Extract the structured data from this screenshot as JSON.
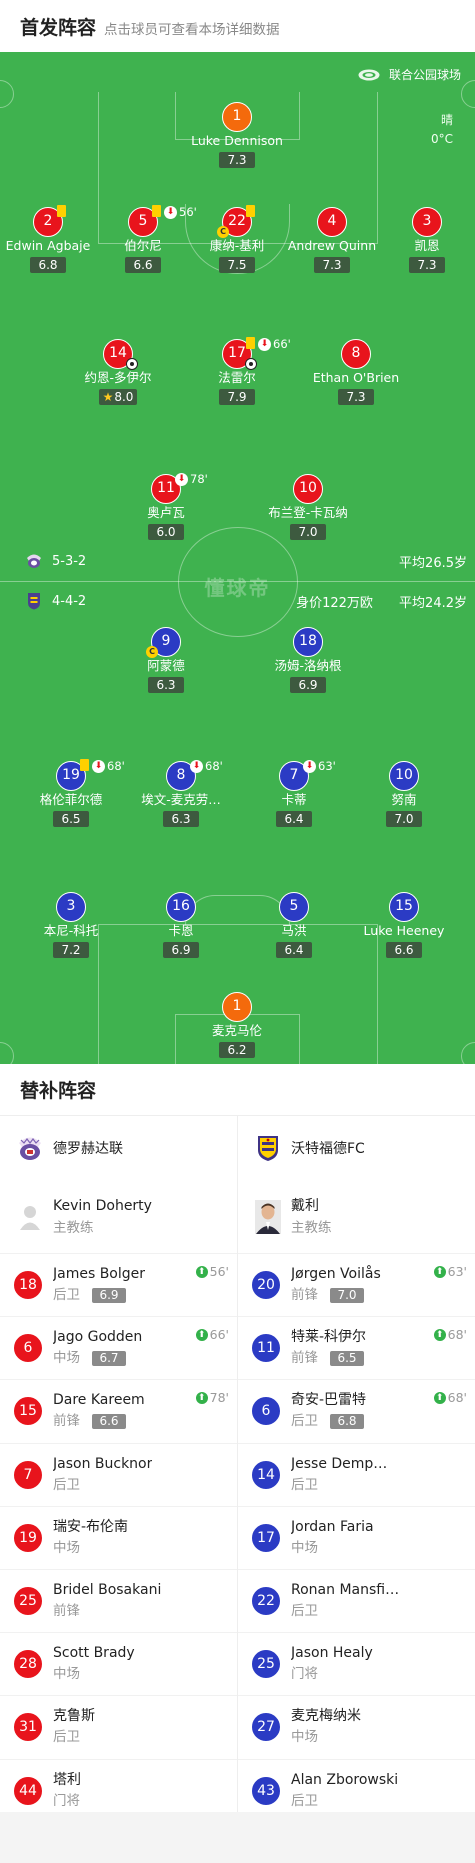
{
  "header": {
    "title": "首发阵容",
    "hint": "点击球员可查看本场详细数据"
  },
  "pitch": {
    "venue": "联合公园球场",
    "weather": "晴",
    "temperature": "0°C",
    "watermark": "懂球帝",
    "home": {
      "formation": "5-3-2",
      "avg_age": "平均26.5岁"
    },
    "away": {
      "formation": "4-4-2",
      "value": "身价122万欧",
      "avg_age": "平均24.2岁"
    },
    "players": [
      {
        "num": "1",
        "name": "Luke Dennison",
        "rating": "7.3",
        "color": "orange"
      },
      {
        "num": "2",
        "name": "Edwin Agbaje",
        "rating": "6.8",
        "color": "red",
        "yellow": true
      },
      {
        "num": "5",
        "name": "伯尔尼",
        "rating": "6.6",
        "color": "red",
        "yellow": true,
        "sub_out": "56'"
      },
      {
        "num": "22",
        "name": "康纳-基利",
        "rating": "7.5",
        "color": "red",
        "yellow": true,
        "captain": true
      },
      {
        "num": "4",
        "name": "Andrew Quinn",
        "rating": "7.3",
        "color": "red"
      },
      {
        "num": "3",
        "name": "凯恩",
        "rating": "7.3",
        "color": "red"
      },
      {
        "num": "14",
        "name": "约恩-多伊尔",
        "rating": "8.0",
        "color": "red",
        "ball": true,
        "star": true
      },
      {
        "num": "17",
        "name": "法雷尔",
        "rating": "7.9",
        "color": "red",
        "yellow": true,
        "sub_out": "66'",
        "ball": true
      },
      {
        "num": "8",
        "name": "Ethan O'Brien",
        "rating": "7.3",
        "color": "red"
      },
      {
        "num": "11",
        "name": "奥卢瓦",
        "rating": "6.0",
        "color": "red",
        "sub_out": "78'"
      },
      {
        "num": "10",
        "name": "布兰登-卡瓦纳",
        "rating": "7.0",
        "color": "red"
      },
      {
        "num": "9",
        "name": "阿蒙德",
        "rating": "6.3",
        "color": "blue",
        "captain": true
      },
      {
        "num": "18",
        "name": "汤姆-洛纳根",
        "rating": "6.9",
        "color": "blue"
      },
      {
        "num": "19",
        "name": "格伦菲尔德",
        "rating": "6.5",
        "color": "blue",
        "yellow": true,
        "sub_out": "68'"
      },
      {
        "num": "8",
        "name": "埃文-麦克劳…",
        "rating": "6.3",
        "color": "blue",
        "sub_out": "68'"
      },
      {
        "num": "7",
        "name": "卡蒂",
        "rating": "6.4",
        "color": "blue",
        "sub_out": "63'"
      },
      {
        "num": "10",
        "name": "努南",
        "rating": "7.0",
        "color": "blue"
      },
      {
        "num": "3",
        "name": "本尼-科托",
        "rating": "7.2",
        "color": "blue"
      },
      {
        "num": "16",
        "name": "卡恩",
        "rating": "6.9",
        "color": "blue"
      },
      {
        "num": "5",
        "name": "马洪",
        "rating": "6.4",
        "color": "blue"
      },
      {
        "num": "15",
        "name": "Luke Heeney",
        "rating": "6.6",
        "color": "blue"
      },
      {
        "num": "1",
        "name": "麦克马伦",
        "rating": "6.2",
        "color": "orange"
      }
    ]
  },
  "subs": {
    "title": "替补阵容",
    "home": {
      "team": "德罗赫达联",
      "coach": {
        "name": "Kevin Doherty",
        "role": "主教练"
      },
      "players": [
        {
          "num": "18",
          "name": "James Bolger",
          "pos": "后卫",
          "rating": "6.9",
          "in": "56'"
        },
        {
          "num": "6",
          "name": "Jago Godden",
          "pos": "中场",
          "rating": "6.7",
          "in": "66'"
        },
        {
          "num": "15",
          "name": "Dare Kareem",
          "pos": "前锋",
          "rating": "6.6",
          "in": "78'"
        },
        {
          "num": "7",
          "name": "Jason Bucknor",
          "pos": "后卫"
        },
        {
          "num": "19",
          "name": "瑞安-布伦南",
          "pos": "中场"
        },
        {
          "num": "25",
          "name": "Bridel Bosakani",
          "pos": "前锋"
        },
        {
          "num": "28",
          "name": "Scott Brady",
          "pos": "中场"
        },
        {
          "num": "31",
          "name": "克鲁斯",
          "pos": "后卫"
        },
        {
          "num": "44",
          "name": "塔利",
          "pos": "门将"
        }
      ]
    },
    "away": {
      "team": "沃特福德FC",
      "coach": {
        "name": "戴利",
        "role": "主教练"
      },
      "players": [
        {
          "num": "20",
          "name": "Jørgen Voilås",
          "pos": "前锋",
          "rating": "7.0",
          "in": "63'"
        },
        {
          "num": "11",
          "name": "特莱-科伊尔",
          "pos": "前锋",
          "rating": "6.5",
          "in": "68'"
        },
        {
          "num": "6",
          "name": "奇安-巴雷特",
          "pos": "后卫",
          "rating": "6.8",
          "in": "68'"
        },
        {
          "num": "14",
          "name": "Jesse Demp…",
          "pos": "后卫"
        },
        {
          "num": "17",
          "name": "Jordan Faria",
          "pos": "中场"
        },
        {
          "num": "22",
          "name": "Ronan Mansfi…",
          "pos": "后卫"
        },
        {
          "num": "25",
          "name": "Jason Healy",
          "pos": "门将"
        },
        {
          "num": "27",
          "name": "麦克梅纳米",
          "pos": "中场"
        },
        {
          "num": "43",
          "name": "Alan Zborowski",
          "pos": "后卫"
        }
      ]
    }
  }
}
